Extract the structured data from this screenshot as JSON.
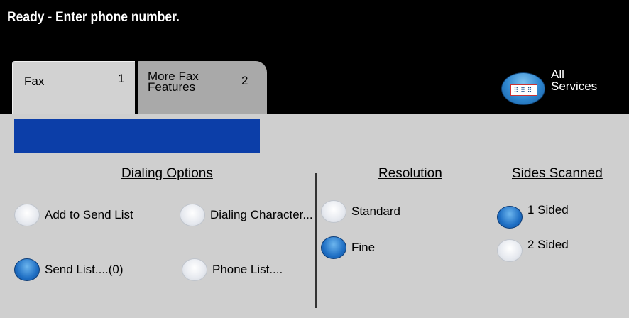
{
  "status": {
    "message": "Ready - Enter phone number."
  },
  "tabs": [
    {
      "label": "Fax",
      "number": "1"
    },
    {
      "label": "More Fax Features",
      "number": "2"
    }
  ],
  "all_services": {
    "label": "All Services",
    "icon": "all-services-icon"
  },
  "entry_field": {
    "value": ""
  },
  "dialing_options": {
    "heading": "Dialing Options",
    "options": [
      {
        "label": "Add to Send List",
        "selected": false
      },
      {
        "label": "Dialing Character...",
        "selected": false
      },
      {
        "label": "Send List....(0)",
        "selected": true
      },
      {
        "label": "Phone List....",
        "selected": false
      }
    ]
  },
  "resolution": {
    "heading": "Resolution",
    "options": [
      {
        "label": "Standard",
        "selected": false
      },
      {
        "label": "Fine",
        "selected": true
      }
    ]
  },
  "sides_scanned": {
    "heading": "Sides Scanned",
    "options": [
      {
        "label": "1 Sided",
        "selected": true
      },
      {
        "label": "2 Sided",
        "selected": false
      }
    ]
  },
  "colors": {
    "selected": "#1f6fc4",
    "entry_bar": "#0c3ea8",
    "background": "#cfcfcf"
  }
}
